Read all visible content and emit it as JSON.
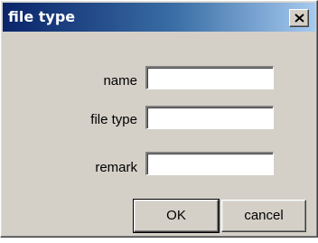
{
  "window": {
    "title": "file type"
  },
  "form": {
    "fields": [
      {
        "label": "name",
        "value": ""
      },
      {
        "label": "file type",
        "value": ""
      },
      {
        "label": "remark",
        "value": ""
      }
    ]
  },
  "buttons": {
    "ok_label": "OK",
    "cancel_label": "cancel"
  },
  "icons": {
    "close": "close-icon"
  },
  "colors": {
    "titlebar_start": "#0a246a",
    "titlebar_end": "#a6caf0",
    "dialog_face": "#d4d0c8"
  }
}
